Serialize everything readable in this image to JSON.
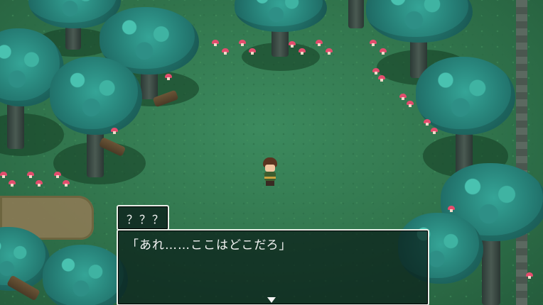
{
  "dialog": {
    "speaker": "？？？",
    "message": "「あれ……ここはどこだろ」"
  },
  "colors": {
    "grass": "#33784f",
    "canopy": "#2f9c8f",
    "mushroom": "#e24d6d",
    "window_border": "#e7eee6"
  },
  "icons": [
    "advance-arrow-icon"
  ]
}
